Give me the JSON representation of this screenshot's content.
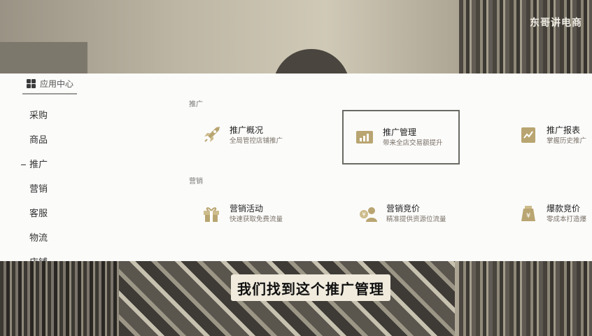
{
  "watermark": "东哥讲电商",
  "app_center": {
    "label": "应用中心",
    "icon": "grid-icon"
  },
  "sidebar": {
    "items": [
      {
        "label": "采购",
        "active": false
      },
      {
        "label": "商品",
        "active": false
      },
      {
        "label": "推广",
        "active": true
      },
      {
        "label": "营销",
        "active": false
      },
      {
        "label": "客服",
        "active": false
      },
      {
        "label": "物流",
        "active": false
      },
      {
        "label": "店铺",
        "active": false
      }
    ]
  },
  "sections": [
    {
      "title": "推广",
      "cards": [
        {
          "title": "推广概况",
          "desc": "全局管控店铺推广",
          "icon": "rocket-icon",
          "highlighted": false
        },
        {
          "title": "推广管理",
          "desc": "带来全店交易额提升",
          "icon": "bar-chart-icon",
          "highlighted": true
        },
        {
          "title": "推广报表",
          "desc": "掌握历史推广",
          "icon": "trend-report-icon",
          "highlighted": false
        }
      ]
    },
    {
      "title": "营销",
      "cards": [
        {
          "title": "营销活动",
          "desc": "快速获取免费流量",
          "icon": "gift-icon",
          "highlighted": false
        },
        {
          "title": "营销竞价",
          "desc": "精准提供资源位流量",
          "icon": "bidding-icon",
          "highlighted": false
        },
        {
          "title": "爆款竞价",
          "desc": "零成本打造爆",
          "icon": "yuan-bag-icon",
          "highlighted": false
        }
      ]
    }
  ],
  "subtitle": "我们找到这个推广管理",
  "colors": {
    "icon_gold": "#b9a571",
    "panel_bg": "#fbfbfa",
    "highlight_border": "#6a6a64"
  }
}
